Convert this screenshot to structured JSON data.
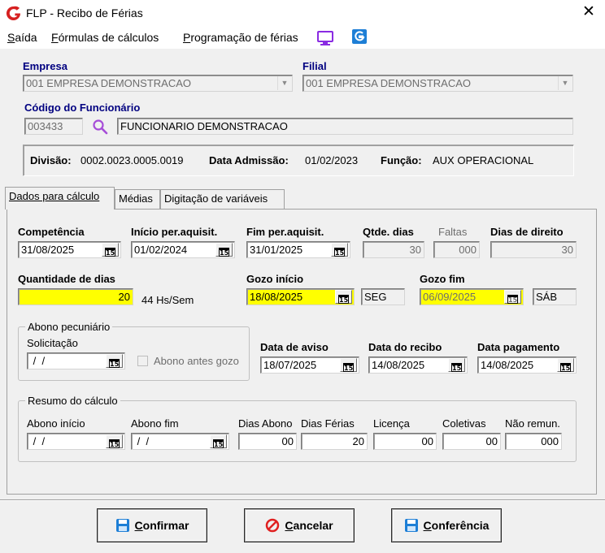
{
  "window": {
    "title": "FLP - Recibo de Férias",
    "close_glyph": "✕"
  },
  "menu": {
    "items": [
      {
        "label": "Saída",
        "accel": "S",
        "rest": "aída"
      },
      {
        "label": "Fórmulas de cálculos",
        "accel": "F",
        "rest": "órmulas de cálculos"
      },
      {
        "label": "Programação de férias",
        "accel": "P",
        "rest": "rogramação de férias"
      }
    ]
  },
  "empresa": {
    "label": "Empresa",
    "value": "001 EMPRESA DEMONSTRACAO"
  },
  "filial": {
    "label": "Filial",
    "value": "001 EMPRESA DEMONSTRACAO"
  },
  "funcionario": {
    "label": "Código do Funcionário",
    "code": "003433",
    "name": "FUNCIONARIO DEMONSTRACAO"
  },
  "info": {
    "divisao_label": "Divisão:",
    "divisao_value": "0002.0023.0005.0019",
    "admissao_label": "Data Admissão:",
    "admissao_value": "01/02/2023",
    "funcao_label": "Função:",
    "funcao_value": "AUX OPERACIONAL"
  },
  "tabs": [
    {
      "label": "Dados para cálculo",
      "active": true
    },
    {
      "label": "Médias",
      "active": false
    },
    {
      "label": "Digitação de variáveis",
      "active": false
    }
  ],
  "calc": {
    "competencia": {
      "label": "Competência",
      "value": "31/08/2025"
    },
    "inicio_aquisit": {
      "label": "Início per.aquisit.",
      "value": "01/02/2024"
    },
    "fim_aquisit": {
      "label": "Fim per.aquisit.",
      "value": "31/01/2025"
    },
    "qtde_dias": {
      "label": "Qtde. dias",
      "value": "30"
    },
    "faltas": {
      "label": "Faltas",
      "value": "000"
    },
    "dias_direito": {
      "label": "Dias de direito",
      "value": "30"
    },
    "quantidade_dias": {
      "label": "Quantidade de dias",
      "value": "20",
      "hint": "44 Hs/Sem"
    },
    "gozo_inicio": {
      "label": "Gozo início",
      "value": "18/08/2025",
      "weekday": "SEG"
    },
    "gozo_fim": {
      "label": "Gozo fim",
      "value": "06/09/2025",
      "weekday": "SÁB"
    },
    "abono": {
      "title": "Abono pecuniário",
      "solicitacao_label": "Solicitação",
      "solicitacao_value": " /  /",
      "antes_gozo_label": "Abono antes gozo"
    },
    "data_aviso": {
      "label": "Data de aviso",
      "value": "18/07/2025"
    },
    "data_recibo": {
      "label": "Data do recibo",
      "value": "14/08/2025"
    },
    "data_pagamento": {
      "label": "Data pagamento",
      "value": "14/08/2025"
    },
    "resumo": {
      "title": "Resumo do cálculo",
      "abono_inicio": {
        "label": "Abono início",
        "value": " /  /"
      },
      "abono_fim": {
        "label": "Abono fim",
        "value": " /  /"
      },
      "dias_abono": {
        "label": "Dias Abono",
        "value": "00"
      },
      "dias_ferias": {
        "label": "Dias Férias",
        "value": "20"
      },
      "licenca": {
        "label": "Licença",
        "value": "00"
      },
      "coletivas": {
        "label": "Coletivas",
        "value": "00"
      },
      "nao_remun": {
        "label": "Não remun.",
        "value": "000"
      }
    }
  },
  "calendar_glyph": "15",
  "buttons": {
    "confirmar": {
      "accel": "C",
      "rest": "onfirmar"
    },
    "cancelar": {
      "accel": "C",
      "rest": "ancelar"
    },
    "conferencia": {
      "accel": "C",
      "rest": "onferência"
    }
  },
  "colors": {
    "accent_blue": "#000080",
    "highlight": "#ffff00",
    "icon_purple": "#8a2be2",
    "icon_blue": "#1e7fd6",
    "logo_red": "#d62020",
    "cancel_red": "#e02020"
  }
}
